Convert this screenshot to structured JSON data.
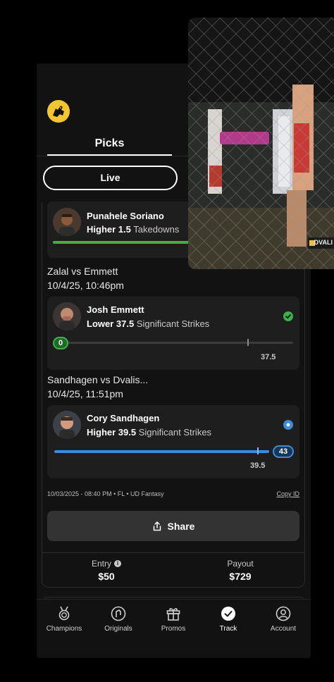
{
  "header": {
    "tab_label": "Picks",
    "filter_label": "Live"
  },
  "picks": [
    {
      "player": "Punahele Soriano",
      "direction": "Higher",
      "line": "1.5",
      "stat": "Takedowns"
    },
    {
      "matchup": "Zalal vs Emmett",
      "datetime": "10/4/25, 10:46pm",
      "player": "Josh Emmett",
      "direction": "Lower",
      "line": "37.5",
      "stat": "Significant Strikes",
      "current_value": "0",
      "line_label": "37.5",
      "status": "won",
      "progress": 0
    },
    {
      "matchup": "Sandhagen vs Dvalis...",
      "datetime": "10/4/25, 11:51pm",
      "player": "Cory Sandhagen",
      "direction": "Higher",
      "line": "39.5",
      "stat": "Significant Strikes",
      "current_value": "43",
      "line_label": "39.5",
      "status": "live",
      "progress": 1.0
    }
  ],
  "entry_meta": "10/03/2025 - 08:40 PM • FL • UD Fantasy",
  "copy_id_label": "Copy ID",
  "share_label": "Share",
  "summary": {
    "entry_label": "Entry",
    "entry_value": "$50",
    "payout_label": "Payout",
    "payout_value": "$729"
  },
  "nav": [
    {
      "label": "Champions",
      "icon": "medal-icon"
    },
    {
      "label": "Originals",
      "icon": "originals-icon"
    },
    {
      "label": "Promos",
      "icon": "gift-icon"
    },
    {
      "label": "Track",
      "icon": "check-circle-icon",
      "active": true
    },
    {
      "label": "Account",
      "icon": "account-icon"
    }
  ],
  "video": {
    "watermark": "DVALI"
  },
  "colors": {
    "accent_green": "#3cb24a",
    "accent_blue": "#3d8bd8",
    "brand_yellow": "#f3c531",
    "background": "#121212",
    "card": "#1e1e1e"
  }
}
